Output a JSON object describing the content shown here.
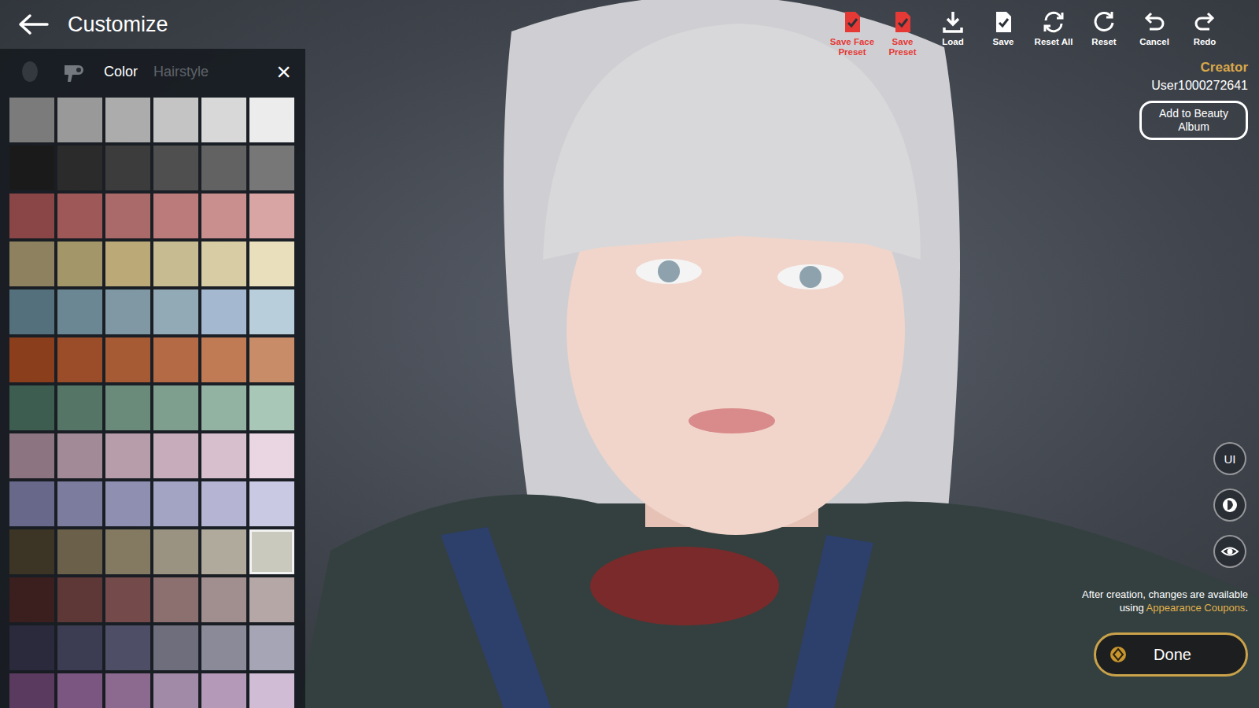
{
  "title": "Customize",
  "toolbar": [
    {
      "kind": "save-face",
      "label": "Save Face Preset",
      "color": "#e53935"
    },
    {
      "kind": "save-preset",
      "label": "Save Preset",
      "color": "#e53935"
    },
    {
      "kind": "load",
      "label": "Load",
      "color": "#ffffff"
    },
    {
      "kind": "save",
      "label": "Save",
      "color": "#ffffff"
    },
    {
      "kind": "reset-all",
      "label": "Reset All",
      "color": "#ffffff"
    },
    {
      "kind": "reset",
      "label": "Reset",
      "color": "#ffffff"
    },
    {
      "kind": "cancel",
      "label": "Cancel",
      "color": "#ffffff"
    },
    {
      "kind": "redo",
      "label": "Redo",
      "color": "#ffffff"
    }
  ],
  "panel": {
    "icon_tabs": [
      {
        "kind": "face",
        "selected": false
      },
      {
        "kind": "dryer",
        "selected": false
      }
    ],
    "tabs": [
      {
        "label": "Color",
        "selected": true
      },
      {
        "label": "Hairstyle",
        "selected": false
      }
    ],
    "close": "×",
    "swatches": [
      {
        "color": "#7b7b7b",
        "selected": false
      },
      {
        "color": "#999999",
        "selected": false
      },
      {
        "color": "#acacac",
        "selected": false
      },
      {
        "color": "#c4c4c4",
        "selected": false
      },
      {
        "color": "#d8d8d8",
        "selected": false
      },
      {
        "color": "#ececec",
        "selected": false
      },
      {
        "color": "#1a1a1a",
        "selected": false
      },
      {
        "color": "#2b2b2b",
        "selected": false
      },
      {
        "color": "#3c3c3c",
        "selected": false
      },
      {
        "color": "#4f4f4f",
        "selected": false
      },
      {
        "color": "#626262",
        "selected": false
      },
      {
        "color": "#777777",
        "selected": false
      },
      {
        "color": "#8a4646",
        "selected": false
      },
      {
        "color": "#9e5858",
        "selected": false
      },
      {
        "color": "#ab6a6a",
        "selected": false
      },
      {
        "color": "#bb7b7b",
        "selected": false
      },
      {
        "color": "#c98e8e",
        "selected": false
      },
      {
        "color": "#d8a4a4",
        "selected": false
      },
      {
        "color": "#8d8160",
        "selected": false
      },
      {
        "color": "#a39669",
        "selected": false
      },
      {
        "color": "#bba978",
        "selected": false
      },
      {
        "color": "#c7bb92",
        "selected": false
      },
      {
        "color": "#d8cca4",
        "selected": false
      },
      {
        "color": "#e9dfbd",
        "selected": false
      },
      {
        "color": "#55707d",
        "selected": false
      },
      {
        "color": "#6c8794",
        "selected": false
      },
      {
        "color": "#7f98a4",
        "selected": false
      },
      {
        "color": "#92aab6",
        "selected": false
      },
      {
        "color": "#a4b8d0",
        "selected": false
      },
      {
        "color": "#b8cfdb",
        "selected": false
      },
      {
        "color": "#8a3e1c",
        "selected": false
      },
      {
        "color": "#9a4d28",
        "selected": false
      },
      {
        "color": "#a75b35",
        "selected": false
      },
      {
        "color": "#b46a45",
        "selected": false
      },
      {
        "color": "#c07a54",
        "selected": false
      },
      {
        "color": "#c98c68",
        "selected": false
      },
      {
        "color": "#3d5d50",
        "selected": false
      },
      {
        "color": "#557566",
        "selected": false
      },
      {
        "color": "#6a8a7a",
        "selected": false
      },
      {
        "color": "#7f9f8e",
        "selected": false
      },
      {
        "color": "#93b3a2",
        "selected": false
      },
      {
        "color": "#a9c7b7",
        "selected": false
      },
      {
        "color": "#8c7480",
        "selected": false
      },
      {
        "color": "#a28a97",
        "selected": false
      },
      {
        "color": "#b79daa",
        "selected": false
      },
      {
        "color": "#c7adbb",
        "selected": false
      },
      {
        "color": "#d8bfcd",
        "selected": false
      },
      {
        "color": "#ead5e2",
        "selected": false
      },
      {
        "color": "#67688a",
        "selected": false
      },
      {
        "color": "#7b7c9e",
        "selected": false
      },
      {
        "color": "#8f90b1",
        "selected": false
      },
      {
        "color": "#a3a3c3",
        "selected": false
      },
      {
        "color": "#b5b5d3",
        "selected": false
      },
      {
        "color": "#c9c9e3",
        "selected": false
      },
      {
        "color": "#3c3424",
        "selected": false
      },
      {
        "color": "#6b604a",
        "selected": false
      },
      {
        "color": "#847a62",
        "selected": false
      },
      {
        "color": "#9a9382",
        "selected": false
      },
      {
        "color": "#b0aa9c",
        "selected": false
      },
      {
        "color": "#c9c9bd",
        "selected": true
      },
      {
        "color": "#3b1e1e",
        "selected": false
      },
      {
        "color": "#5e3737",
        "selected": false
      },
      {
        "color": "#744a4a",
        "selected": false
      },
      {
        "color": "#8c7070",
        "selected": false
      },
      {
        "color": "#a18e8e",
        "selected": false
      },
      {
        "color": "#b4a7a5",
        "selected": false
      },
      {
        "color": "#2a2a3c",
        "selected": false
      },
      {
        "color": "#3c3c52",
        "selected": false
      },
      {
        "color": "#4e4e66",
        "selected": false
      },
      {
        "color": "#6e6e7c",
        "selected": false
      },
      {
        "color": "#8a8a98",
        "selected": false
      },
      {
        "color": "#a5a5b5",
        "selected": false
      },
      {
        "color": "#5a3a5e",
        "selected": false
      },
      {
        "color": "#7a5680",
        "selected": false
      },
      {
        "color": "#8c6a90",
        "selected": false
      },
      {
        "color": "#a08aa8",
        "selected": false
      },
      {
        "color": "#b49ab8",
        "selected": false
      },
      {
        "color": "#d0bcd4",
        "selected": false
      }
    ]
  },
  "creator": {
    "label": "Creator",
    "name": "User1000272641"
  },
  "album_button": "Add to Beauty Album",
  "side_buttons": [
    {
      "kind": "text",
      "label": "UI"
    },
    {
      "kind": "portrait"
    },
    {
      "kind": "eye"
    }
  ],
  "note": {
    "text": "After creation, changes are available using ",
    "link": "Appearance Coupons",
    "end": "."
  },
  "done": "Done"
}
